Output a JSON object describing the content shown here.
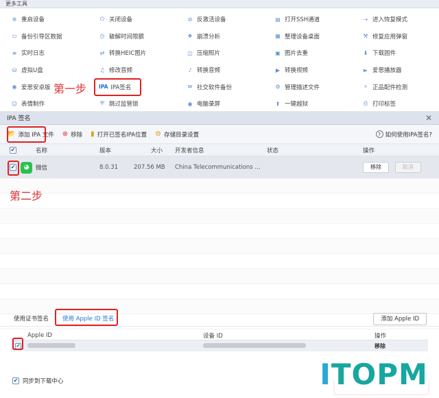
{
  "tools": {
    "header": "更多工具",
    "items": [
      {
        "label": "重启设备",
        "icon": "restart-icon",
        "glyph": "✲"
      },
      {
        "label": "关闭设备",
        "icon": "power-icon",
        "glyph": "⏻"
      },
      {
        "label": "反激活设备",
        "icon": "deactivate-icon",
        "glyph": "⊘"
      },
      {
        "label": "打开SSH通道",
        "icon": "ssh-icon",
        "glyph": "▤"
      },
      {
        "label": "进入恢复模式",
        "icon": "recovery-icon",
        "glyph": "⇢"
      },
      {
        "label": "备份引导区数据",
        "icon": "backup-icon",
        "glyph": "▭"
      },
      {
        "label": "破解时间限额",
        "icon": "clock-icon",
        "glyph": "◷"
      },
      {
        "label": "崩溃分析",
        "icon": "crash-icon",
        "glyph": "❖"
      },
      {
        "label": "整理设备桌面",
        "icon": "desktop-icon",
        "glyph": "▦"
      },
      {
        "label": "修复应用弹窗",
        "icon": "repair-icon",
        "glyph": "⚒"
      },
      {
        "label": "实时日志",
        "icon": "log-icon",
        "glyph": "≡"
      },
      {
        "label": "转换HEIC图片",
        "icon": "heic-icon",
        "glyph": "⇄"
      },
      {
        "label": "压缩照片",
        "icon": "compress-icon",
        "glyph": "◫"
      },
      {
        "label": "图片去重",
        "icon": "dedupe-icon",
        "glyph": "▣"
      },
      {
        "label": "下载固件",
        "icon": "download-firmware-icon",
        "glyph": "⬇"
      },
      {
        "label": "虚拟U盘",
        "icon": "usb-icon",
        "glyph": "⛁"
      },
      {
        "label": "修改音频",
        "icon": "audio-edit-icon",
        "glyph": "♫"
      },
      {
        "label": "转换音频",
        "icon": "audio-convert-icon",
        "glyph": "♪"
      },
      {
        "label": "转换视频",
        "icon": "video-convert-icon",
        "glyph": "▶"
      },
      {
        "label": "爱思播放器",
        "icon": "player-icon",
        "glyph": "►"
      },
      {
        "label": "爱思安卓版",
        "icon": "android-icon",
        "glyph": "◉"
      },
      {
        "label": "IPA签名",
        "icon": "ipa-sign-icon",
        "glyph": "IPA",
        "ipa": true
      },
      {
        "label": "社交软件备份",
        "icon": "social-backup-icon",
        "glyph": "✉"
      },
      {
        "label": "管理描述文件",
        "icon": "profile-icon",
        "glyph": "⚙"
      },
      {
        "label": "正品配件检测",
        "icon": "accessory-check-icon",
        "glyph": "⚡"
      },
      {
        "label": "表情制作",
        "icon": "emoji-icon",
        "glyph": "☺"
      },
      {
        "label": "跳过监管锁",
        "icon": "supervision-icon",
        "glyph": "⛨"
      },
      {
        "label": "电脑录屏",
        "icon": "record-icon",
        "glyph": "◉"
      },
      {
        "label": "一键越狱",
        "icon": "jailbreak-icon",
        "glyph": "⬆"
      },
      {
        "label": "打印标签",
        "icon": "print-icon",
        "glyph": "⎙"
      }
    ]
  },
  "annotations": {
    "step1": "第一步",
    "step2": "第二步"
  },
  "dialog": {
    "title": "IPA 签名",
    "toolbar": {
      "add_ipa": "添加 IPA 文件",
      "remove": "移除",
      "open_location": "打开已签名IPA位置",
      "storage_settings": "存储目录设置",
      "help": "如何使用IPA签名?"
    },
    "columns": {
      "name": "名称",
      "version": "版本",
      "size": "大小",
      "developer": "开发者信息",
      "status": "状态",
      "action": "操作"
    },
    "app": {
      "name": "微信",
      "version": "8.0.31",
      "size": "207.56 MB",
      "developer": "China Telecommunications ...",
      "remove": "移除",
      "cancel": "取消",
      "checked": "✔"
    },
    "sign": {
      "tab_cert": "使用证书签名",
      "tab_appleid": "使用 Apple ID 签名",
      "add_appleid": "添加 Apple ID",
      "col_appleid": "Apple ID",
      "col_device": "设备 ID",
      "col_action": "操作",
      "row_remove": "移除",
      "sync": "同步到下载中心"
    }
  },
  "watermark": {
    "i": "I",
    "rest": "TOPM"
  },
  "colors": {
    "accent": "#2a73d6",
    "annotation_red": "#e02020",
    "wechat_green": "#29c24f"
  }
}
